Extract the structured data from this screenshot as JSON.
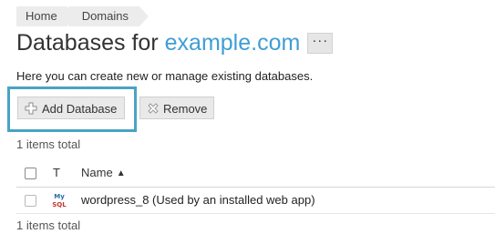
{
  "breadcrumb": {
    "items": [
      "Home",
      "Domains"
    ]
  },
  "title": {
    "prefix": "Databases for",
    "domain": "example.com",
    "more_label": "···"
  },
  "hint": "Here you can create new or manage existing databases.",
  "toolbar": {
    "add_label": "Add Database",
    "remove_label": "Remove"
  },
  "totals": {
    "top": "1 items total",
    "bottom": "1 items total"
  },
  "table": {
    "columns": {
      "type": "T",
      "name": "Name"
    },
    "sort": {
      "column": "Name",
      "direction": "ascending"
    },
    "rows": [
      {
        "type_icon": "mysql-icon",
        "name": "wordpress_8 (Used by an installed web app)"
      }
    ]
  },
  "colors": {
    "accent": "#3f9ed4",
    "highlight": "#4aa3c4"
  }
}
